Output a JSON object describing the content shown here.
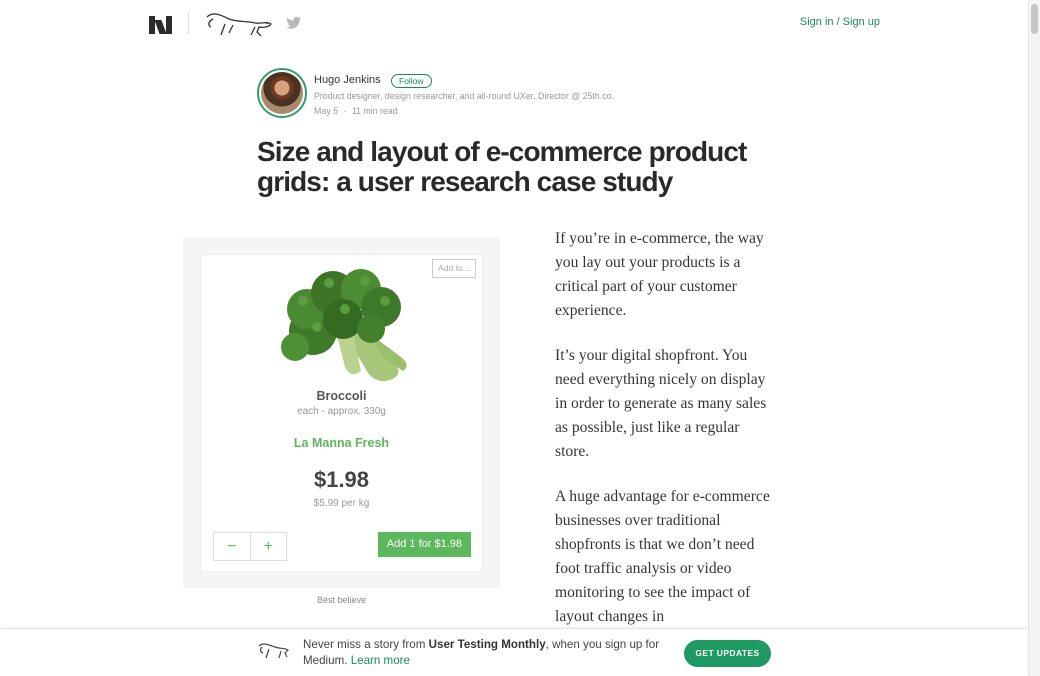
{
  "nav": {
    "signin_label": "Sign in / Sign up"
  },
  "author": {
    "name": "Hugo Jenkins",
    "follow_label": "Follow",
    "bio": "Product designer, design researcher, and all-round UXer. Director @ 25th.co.",
    "date": "May 5",
    "read_time": "11 min read",
    "separator": "·"
  },
  "article": {
    "title_line1": "Size and layout of e-commerce product",
    "title_line2": "grids: a user research case study",
    "paragraphs": [
      "If you’re in e-commerce, the way you lay out your products is a critical part of your customer experience.",
      "It’s your digital shopfront. You need everything nicely on display in order to generate as many sales as possible, just like a regular store.",
      "A huge advantage for e-commerce businesses over traditional shopfronts is that we don’t need foot traffic analysis or video monitoring to see the impact of layout changes in"
    ]
  },
  "figure": {
    "addto_label": "Add to...",
    "product_name": "Broccoli",
    "product_size": "each - approx. 330g",
    "store": "La Manna Fresh",
    "price": "$1.98",
    "unit_price": "$5.99 per kg",
    "minus": "−",
    "plus": "+",
    "add_button": "Add 1 for $1.98",
    "caption": "Best believe"
  },
  "banner": {
    "text_before": "Never miss a story from ",
    "publication": "User Testing Monthly",
    "text_after": ", when you sign up for Medium. ",
    "learn_more": "Learn more",
    "cta": "GET UPDATES"
  },
  "colors": {
    "accent": "#1b8a5a",
    "product_green": "#5cb85c",
    "cta_green": "#1e9a62"
  }
}
